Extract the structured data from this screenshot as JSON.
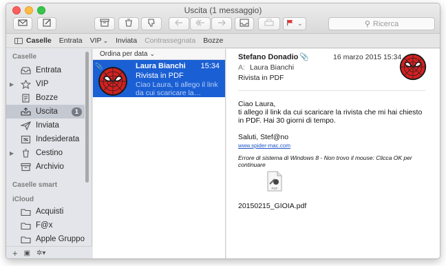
{
  "window": {
    "title": "Uscita (1 messaggio)"
  },
  "toolbar": {
    "buttons": [
      {
        "name": "get-mail",
        "icon": "envelope-icon"
      },
      {
        "name": "compose",
        "icon": "compose-icon"
      },
      {
        "name": "archive",
        "icon": "archive-box-icon"
      },
      {
        "name": "delete",
        "icon": "trash-icon"
      },
      {
        "name": "junk",
        "icon": "thumbs-down-icon"
      },
      {
        "name": "reply",
        "icon": "reply-icon"
      },
      {
        "name": "reply-all",
        "icon": "reply-all-icon"
      },
      {
        "name": "forward",
        "icon": "forward-icon"
      },
      {
        "name": "show-inbox",
        "icon": "inbox-icon"
      },
      {
        "name": "print",
        "icon": "printer-icon"
      },
      {
        "name": "flag",
        "icon": "flag-icon"
      }
    ],
    "search_placeholder": "Ricerca"
  },
  "favorites_bar": {
    "items": [
      "Caselle",
      "Entrata",
      "VIP",
      "Inviata",
      "Contrassegnata",
      "Bozze"
    ],
    "vip_chevron": "⌄"
  },
  "sidebar": {
    "section_caselle": "Caselle",
    "section_smart": "Caselle smart",
    "section_icloud": "iCloud",
    "mailboxes": [
      {
        "label": "Entrata",
        "icon": "inbox-tray-icon",
        "disclosure": ""
      },
      {
        "label": "VIP",
        "icon": "star-icon",
        "disclosure": "▶"
      },
      {
        "label": "Bozze",
        "icon": "draft-doc-icon",
        "disclosure": ""
      },
      {
        "label": "Uscita",
        "icon": "outbox-tray-icon",
        "disclosure": "",
        "badge": "1",
        "selected": true
      },
      {
        "label": "Inviata",
        "icon": "paper-plane-icon",
        "disclosure": ""
      },
      {
        "label": "Indesiderata",
        "icon": "junk-box-icon",
        "disclosure": ""
      },
      {
        "label": "Cestino",
        "icon": "trash-icon",
        "disclosure": "▶"
      },
      {
        "label": "Archivio",
        "icon": "archive-box-icon",
        "disclosure": ""
      }
    ],
    "icloud": [
      {
        "label": "Acquisti",
        "icon": "folder-icon"
      },
      {
        "label": "F@x",
        "icon": "folder-icon"
      },
      {
        "label": "Apple Gruppo",
        "icon": "folder-icon"
      }
    ],
    "bottom": {
      "add": "+",
      "view": "▣",
      "action": "✲▾"
    }
  },
  "message_list": {
    "sort_label": "Ordina per data",
    "sort_chevron": "⌄",
    "messages": [
      {
        "from": "Laura Bianchi",
        "time": "15:34",
        "subject": "Rivista in PDF",
        "preview": "Ciao Laura, ti allego il link da cui scaricare la…",
        "has_attachment": true,
        "selected": true
      }
    ]
  },
  "reader": {
    "from": "Stefano Donadio",
    "date": "16 marzo 2015 15:34",
    "to_label": "A:",
    "to": "Laura Bianchi",
    "subject": "Rivista in PDF",
    "body_greeting": "Ciao Laura,",
    "body_text": "ti allego il link da cui scaricare la rivista che mi hai chiesto in PDF. Hai 30 giorni di tempo.",
    "signoff": "Saluti, Stef@no",
    "link": "www.spider-mac.com",
    "signature_note": "Errore di sistema di Windows 8 - Non trovo il mouse: Clicca OK per continuare",
    "attachment_name": "20150215_GIOIA.pdf",
    "attachment_icon_label": "PDF"
  },
  "colors": {
    "selection_blue": "#1b5fd4",
    "flag_red": "#e0312d",
    "link_blue": "#1f55c9",
    "badge_gray": "#757a85"
  }
}
